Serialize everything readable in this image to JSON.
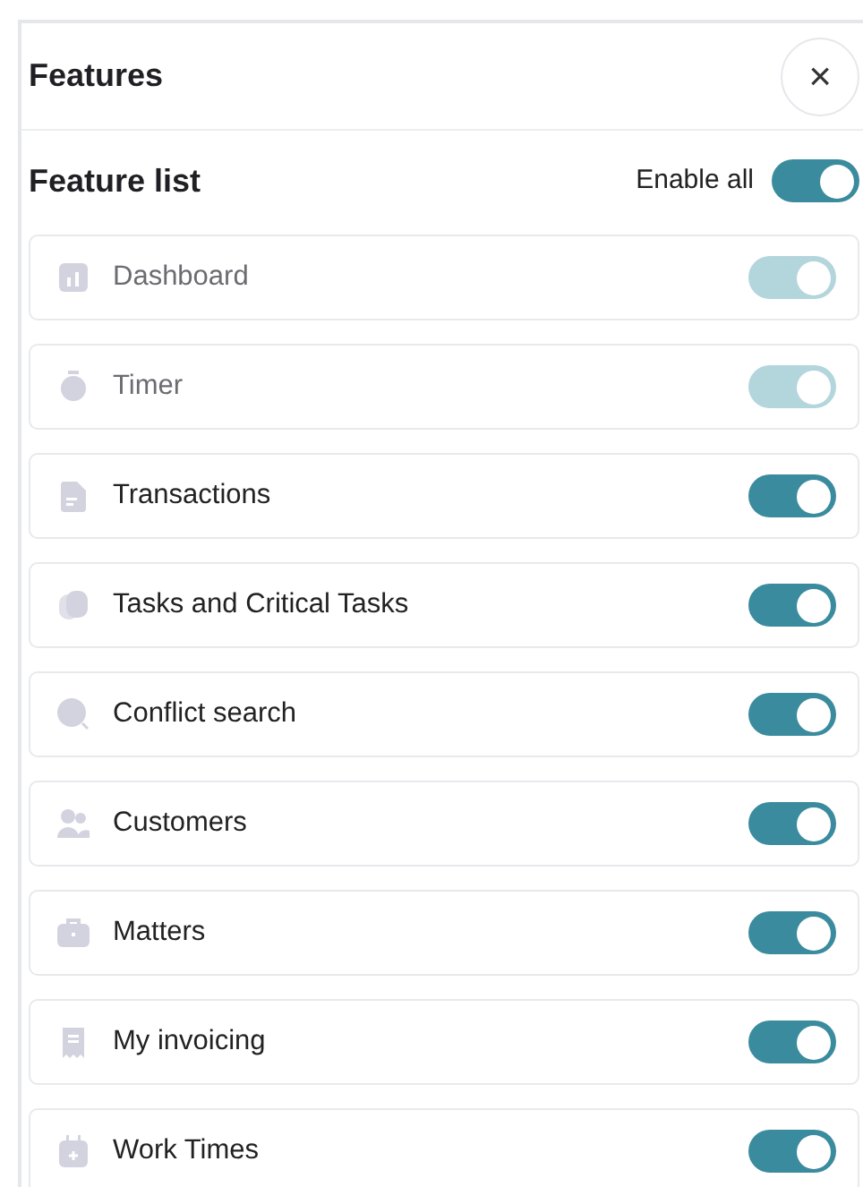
{
  "header": {
    "title": "Features",
    "close": "×"
  },
  "feature_list": {
    "title": "Feature list",
    "enable_all": {
      "label": "Enable all",
      "on": true
    },
    "items": [
      {
        "label": "Dashboard",
        "on": true,
        "disabled": true
      },
      {
        "label": "Timer",
        "on": true,
        "disabled": true
      },
      {
        "label": "Transactions",
        "on": true,
        "disabled": false
      },
      {
        "label": "Tasks and Critical Tasks",
        "on": true,
        "disabled": false
      },
      {
        "label": "Conflict search",
        "on": true,
        "disabled": false
      },
      {
        "label": "Customers",
        "on": true,
        "disabled": false
      },
      {
        "label": "Matters",
        "on": true,
        "disabled": false
      },
      {
        "label": "My invoicing",
        "on": true,
        "disabled": false
      },
      {
        "label": "Work Times",
        "on": true,
        "disabled": false
      }
    ]
  }
}
